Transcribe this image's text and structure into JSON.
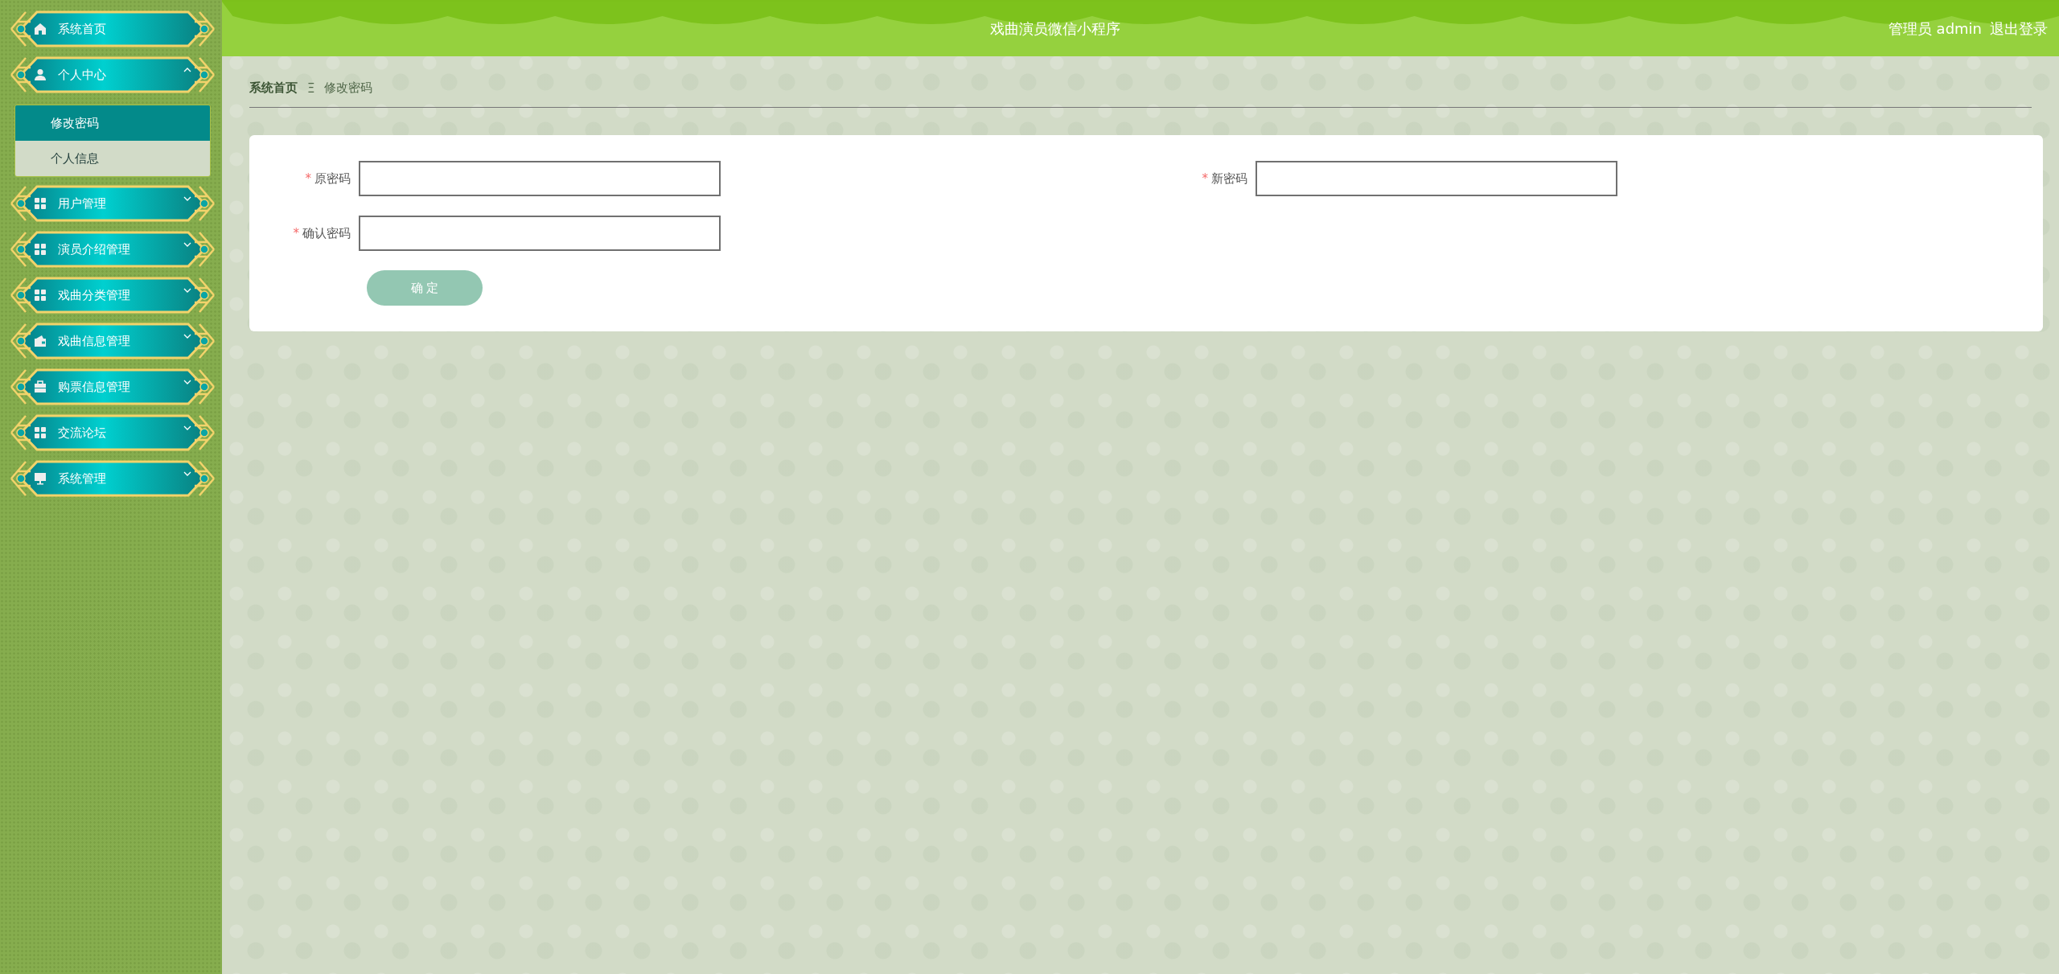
{
  "sidebar": {
    "items": [
      {
        "label": "系统首页",
        "kind": "home"
      },
      {
        "label": "个人中心",
        "kind": "user",
        "expanded": true,
        "children": [
          {
            "label": "修改密码",
            "selected": true
          },
          {
            "label": "个人信息",
            "selected": false
          }
        ]
      },
      {
        "label": "用户管理",
        "kind": "grid",
        "expanded": false
      },
      {
        "label": "演员介绍管理",
        "kind": "grid",
        "expanded": false
      },
      {
        "label": "戏曲分类管理",
        "kind": "grid",
        "expanded": false
      },
      {
        "label": "戏曲信息管理",
        "kind": "wallet",
        "expanded": false
      },
      {
        "label": "购票信息管理",
        "kind": "briefcase",
        "expanded": false
      },
      {
        "label": "交流论坛",
        "kind": "grid",
        "expanded": false
      },
      {
        "label": "系统管理",
        "kind": "monitor",
        "expanded": false
      }
    ]
  },
  "header": {
    "title": "戏曲演员微信小程序",
    "user": "管理员 admin",
    "logout": "退出登录"
  },
  "breadcrumb": {
    "items": [
      "系统首页",
      "修改密码"
    ],
    "separator": "Ξ"
  },
  "form": {
    "fields": [
      {
        "label": "原密码",
        "required_mark": "*"
      },
      {
        "label": "新密码",
        "required_mark": "*"
      },
      {
        "label": "确认密码",
        "required_mark": "*"
      }
    ],
    "submit": "确 定"
  }
}
